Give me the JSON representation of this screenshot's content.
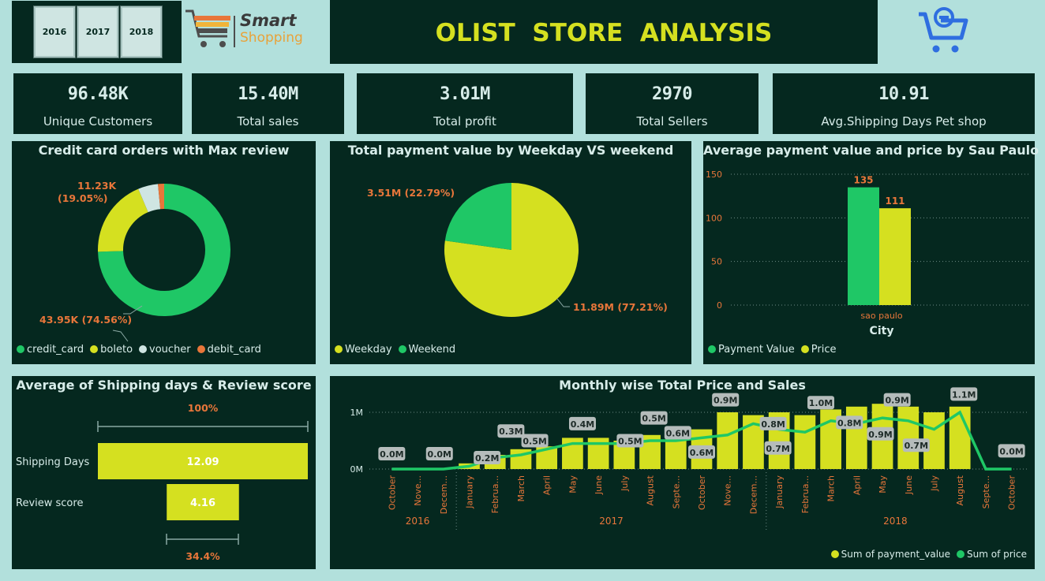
{
  "years": [
    "2016",
    "2017",
    "2018"
  ],
  "logo": {
    "line1": "Smart",
    "line2": "Shopping"
  },
  "title": "OLIST  STORE  ANALYSIS",
  "kpis": [
    {
      "value": "96.48K",
      "label": "Unique Customers"
    },
    {
      "value": "15.40M",
      "label": "Total sales"
    },
    {
      "value": "3.01M",
      "label": "Total profit"
    },
    {
      "value": "2970",
      "label": "Total Sellers"
    },
    {
      "value": "10.91",
      "label": "Avg.Shipping Days Pet shop"
    }
  ],
  "colors": {
    "green": "#1fc766",
    "yellow": "#d5e020",
    "orange": "#e8763a",
    "light": "#d7ece9",
    "bg": "#05281f",
    "page": "#b2e0dc"
  },
  "donut": {
    "title": "Credit card orders with Max review",
    "label_top_1": "11.23K",
    "label_top_2": "(19.05%)",
    "label_bottom": "43.95K (74.56%)",
    "legend": [
      "credit_card",
      "boleto",
      "voucher",
      "debit_card"
    ]
  },
  "pie": {
    "title": "Total payment value by Weekday VS weekend",
    "label_weekend": "3.51M (22.79%)",
    "label_weekday": "11.89M (77.21%)",
    "legend": [
      "Weekday",
      "Weekend"
    ]
  },
  "bar_city": {
    "title": "Average payment value and price by Sau Paulo",
    "axis_title": "City",
    "legend": [
      "Payment Value",
      "Price"
    ]
  },
  "shipping": {
    "title": "Average of Shipping days & Review score",
    "top_pct": "100%",
    "bottom_pct": "34.4%",
    "legend_label_1": "Shipping Days",
    "legend_label_2": "Review score"
  },
  "monthly": {
    "title": "Monthly wise Total Price and Sales",
    "legend": [
      "Sum of payment_value",
      "Sum of price"
    ]
  },
  "chart_data": [
    {
      "type": "pie",
      "title": "Credit card orders with Max review",
      "donut": true,
      "slices": [
        {
          "name": "credit_card",
          "value": 74.56
        },
        {
          "name": "boleto",
          "value": 19.05
        },
        {
          "name": "voucher",
          "value": 4.89
        },
        {
          "name": "debit_card",
          "value": 1.5
        }
      ]
    },
    {
      "type": "pie",
      "title": "Total payment value by Weekday VS weekend",
      "slices": [
        {
          "name": "Weekday",
          "value": 77.21
        },
        {
          "name": "Weekend",
          "value": 22.79
        }
      ]
    },
    {
      "type": "bar",
      "title": "Average payment value and price by Sau Paulo",
      "categories": [
        "sao paulo"
      ],
      "xlabel": "City",
      "ylim": [
        0,
        150
      ],
      "yticks": [
        "0",
        "50",
        "100",
        "150"
      ],
      "series": [
        {
          "name": "Payment Value",
          "values": [
            135
          ]
        },
        {
          "name": "Price",
          "values": [
            111
          ]
        }
      ],
      "value_labels": [
        "135",
        "111"
      ]
    },
    {
      "type": "bar",
      "title": "Average of Shipping days & Review score",
      "categories": [
        "Shipping Days",
        "Review score"
      ],
      "values": [
        12.09,
        4.16
      ],
      "value_labels": [
        "12.09",
        "4.16"
      ]
    },
    {
      "type": "bar",
      "title": "Monthly wise Total Price and Sales",
      "ylim": [
        0,
        1.25
      ],
      "yticks": [
        "0M",
        "1M"
      ],
      "x": [
        "October",
        "Nove...",
        "Decem...",
        "January",
        "Februa...",
        "March",
        "April",
        "May",
        "June",
        "July",
        "August",
        "Septe...",
        "October",
        "Nove...",
        "Decem...",
        "January",
        "Februa...",
        "March",
        "April",
        "May",
        "June",
        "July",
        "August",
        "Septe...",
        "October"
      ],
      "years": [
        {
          "label": "2016",
          "start": 0,
          "end": 2
        },
        {
          "label": "2017",
          "start": 3,
          "end": 14
        },
        {
          "label": "2018",
          "start": 15,
          "end": 24
        }
      ],
      "series": [
        {
          "name": "Sum of payment_value",
          "values": [
            0.0,
            0.0,
            0.0,
            0.1,
            0.25,
            0.35,
            0.4,
            0.55,
            0.55,
            0.5,
            0.6,
            0.65,
            0.7,
            1.0,
            0.95,
            1.0,
            0.95,
            1.05,
            1.1,
            1.15,
            1.1,
            1.0,
            1.1,
            0.0,
            0.0
          ]
        },
        {
          "name": "Sum of price",
          "values": [
            0.0,
            0.0,
            0.0,
            0.05,
            0.2,
            0.25,
            0.35,
            0.45,
            0.45,
            0.45,
            0.5,
            0.5,
            0.55,
            0.6,
            0.8,
            0.7,
            0.65,
            0.85,
            0.8,
            0.9,
            0.85,
            0.7,
            1.0,
            0.0,
            0.0
          ]
        }
      ],
      "labels": [
        "0.0M",
        "0.0M",
        "0.2M",
        "0.3M",
        "0.5M",
        "0.4M",
        "0.5M",
        "0.5M",
        "0.6M",
        "0.6M",
        "0.9M",
        "0.8M",
        "0.7M",
        "1.0M",
        "0.8M",
        "0.9M",
        "0.9M",
        "0.7M",
        "1.1M",
        "0.0M"
      ]
    }
  ]
}
